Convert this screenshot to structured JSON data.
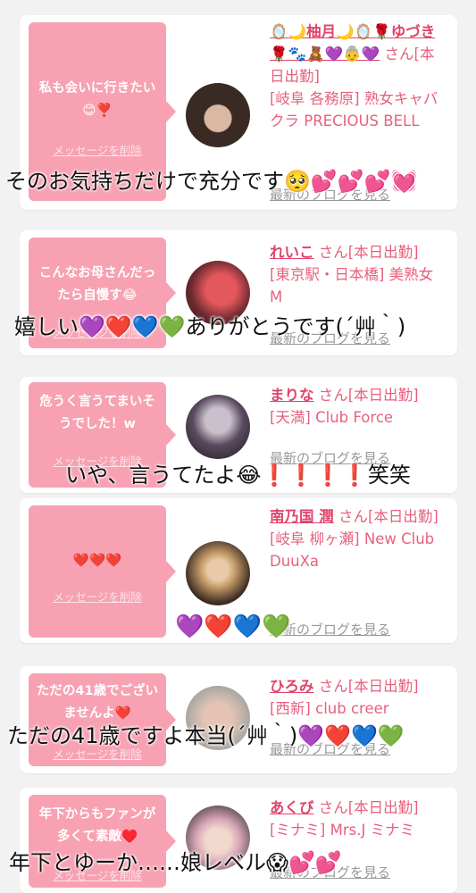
{
  "cards": [
    {
      "message": "私も会いに行きたい😊❣️",
      "delete_label": "メッセージを削除",
      "name": "🪞🌙柚月🌙🪞🌹ゆづき🌹🐾🧸💜👵💜",
      "san": "さん",
      "status": "[本日出勤]",
      "shop": "[岐阜 各務原] 熟女キャバクラ PRECIOUS BELL",
      "blog": "最新のブログを見る",
      "caption": "そのお気持ちだけで充分です🥺💕💕💕💓"
    },
    {
      "message": "こんなお母さんだったら自慢す😂",
      "delete_label": "メッセージを削除",
      "name": "れいこ",
      "san": "さん",
      "status": "[本日出勤]",
      "shop": "[東京駅・日本橋] 美熟女 M",
      "blog": "最新のブログを見る",
      "caption": "嬉しい💜❤️💙💚ありがとうです(´艸｀)"
    },
    {
      "message": "危うく言うてまいそうでした！w",
      "delete_label": "メッセージを削除",
      "name": "まりな",
      "san": "さん",
      "status": "[本日出勤]",
      "shop": "[天満] Club Force",
      "blog": "最新のブログを見る",
      "caption": "いや、言うてたよ😂❗️❗️❗️❗️笑笑"
    },
    {
      "message": "❤️❤️❤️",
      "delete_label": "メッセージを削除",
      "name": "南乃国 潤",
      "san": "さん",
      "status": "[本日出勤]",
      "shop": "[岐阜 柳ヶ瀬] New Club DuuXa",
      "blog": "最新のブログを見る",
      "caption": "💜❤️💙💚"
    },
    {
      "message": "ただの41歳でございませんよ❤️",
      "delete_label": "メッセージを削除",
      "name": "ひろみ",
      "san": "さん",
      "status": "[本日出勤]",
      "shop": "[西新] club creer",
      "blog": "最新のブログを見る",
      "caption": "ただの41歳ですよ本当(´艸｀)💜❤️💙💚"
    },
    {
      "message": "年下からもファンが多くて素敵♥️",
      "delete_label": "メッセージを削除",
      "name": "あくび",
      "san": "さん",
      "status": "[本日出勤]",
      "shop": "[ミナミ] Mrs.J ミナミ",
      "blog": "最新のブログを見る",
      "caption": "年下とゆーか……娘レベル😱💕💕"
    }
  ],
  "colors": {
    "bubble": "#f7a1b3",
    "name": "#e0446a",
    "info": "#e8607d",
    "background": "#f2f2f2"
  },
  "avatars": [
    "avatar-photo-woman-dark-hair",
    "avatar-photo-red-sticker",
    "avatar-photo-mirror-selfie",
    "avatar-photo-woman-blonde",
    "avatar-photo-hands-nails",
    "avatar-photo-cat-ears-filter"
  ]
}
